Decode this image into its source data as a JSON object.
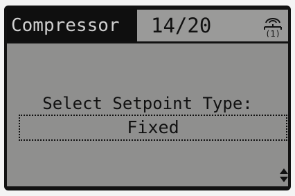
{
  "header": {
    "menu_title": "Compressor",
    "page_indicator": "14/20",
    "status_icon": "network-icon"
  },
  "main": {
    "prompt": "Select Setpoint Type:",
    "selected_value": "Fixed"
  },
  "footer": {
    "scroll_icon": "up-down-arrows-icon"
  },
  "colors": {
    "lcd_background": "#8f8f8e",
    "title_bar": "#0f0f0f",
    "title_text": "#cfcfcf",
    "text": "#111111"
  }
}
